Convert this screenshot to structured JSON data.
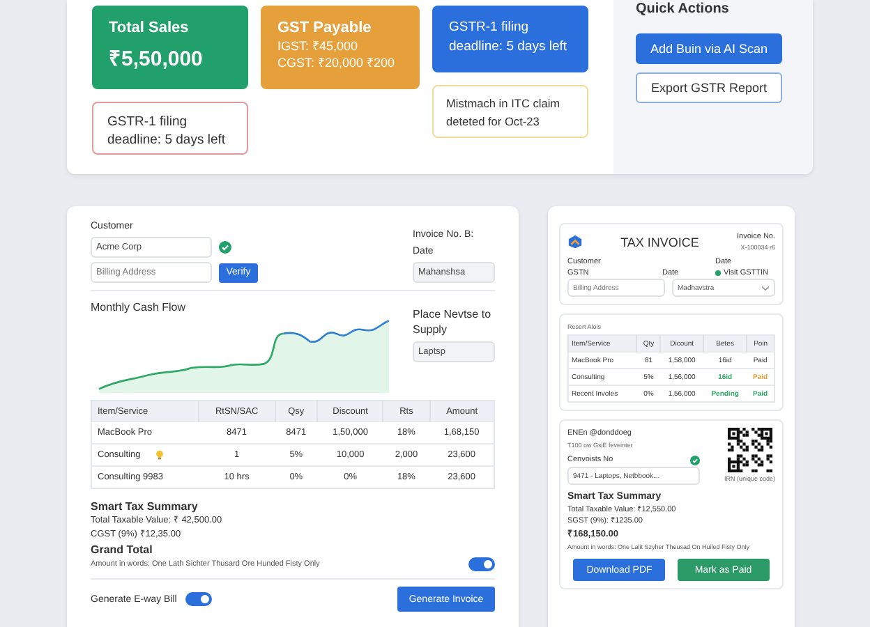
{
  "stats": [
    {
      "title": "Total Sales",
      "value": "₹5,50,000",
      "color": "#21a06b"
    },
    {
      "title": "GST Payable",
      "lines": [
        "IGST: ₹45,000",
        "CGST: ₹20,000 ₹200"
      ],
      "color": "#e5a03c"
    },
    {
      "title": "GSTR-1 filing deadline: 5 days left",
      "color": "#2a6fdb"
    }
  ],
  "alerts": [
    {
      "text": "GSTR-1 filing deadline: 5 days left",
      "color": "#e39a9a"
    },
    {
      "text": "Mistmach in ITC claim deteted for Oct-23",
      "color": "#f0dd9a"
    }
  ],
  "quick_actions": {
    "title": "Quick Actions",
    "buttons": [
      {
        "label": "Add Buin via AI Scan",
        "primary": true
      },
      {
        "label": "Export GSTR Report",
        "primary": false
      }
    ]
  },
  "invoice_form": {
    "customer_label": "Customer",
    "customer_value": "Acme Corp",
    "customer_verified": true,
    "billing_placeholder": "Billing Address",
    "verify_button": "Verify",
    "invoice_no_label": "Invoice No. B:",
    "date_label": "Date",
    "date_value": "Mahanshsa",
    "chart_title": "Monthly Cash Flow",
    "place_label": "Place Nevtse to Supply",
    "place_value": "Laptsp",
    "columns": [
      "Item/Service",
      "RtSN/SAC",
      "Qsy",
      "Discount",
      "Rts",
      "Amount"
    ],
    "rows": [
      {
        "cells": [
          "MacBook Pro",
          "8471",
          "8471",
          "1,50,000",
          "18%",
          "1,68,150"
        ],
        "hint": false
      },
      {
        "cells": [
          "Consulting",
          "1",
          "5%",
          "10,000",
          "2,000",
          "23,600"
        ],
        "hint": true
      },
      {
        "cells": [
          "Consulting   9983",
          "10 hrs",
          "0%",
          "0%",
          "18%",
          "23,600"
        ],
        "hint": false
      }
    ],
    "summary_title": "Smart Tax Summary",
    "summary_lines": [
      "Total Taxable Value: ₹ 42,500.00",
      "CGST (9%) ₹12,35.00"
    ],
    "grand_total_label": "Grand Total",
    "amount_words": "Amount in words: One Lath Sichter Thusard Ore Hunded Fisty Only",
    "words_toggle_on": true,
    "eway_label": "Generate E-way Bill",
    "eway_on": true,
    "generate_button": "Generate Invoice"
  },
  "invoice_preview": {
    "title": "TAX INVOICE",
    "invoice_no_label": "Invoice No.",
    "invoice_no": "X-100034 r6",
    "customer_label": "Customer",
    "date_label": "Date",
    "gstn_label": "GSTN",
    "date_label_2": "Date",
    "visit_label": "Visit GSTTIN",
    "billing_placeholder": "Billing Address",
    "state_value": "Madhavstra",
    "alerts_title": "Resert Alois",
    "columns": [
      "Item/Service",
      "Qty",
      "Dicount",
      "Betes",
      "Poin"
    ],
    "rows": [
      {
        "cells": [
          "MacBook Pro",
          "81",
          "1,58,000"
        ],
        "status": {
          "text": "16id",
          "confirmed": false
        },
        "payment": {
          "text": "Paid",
          "confirmed": false,
          "pending": false
        }
      },
      {
        "cells": [
          "Consulting",
          "5%",
          "1,56,000"
        ],
        "status": {
          "text": "16id",
          "confirmed": true
        },
        "payment": {
          "text": "Paid",
          "confirmed": false,
          "pending": true
        }
      },
      {
        "cells": [
          "Recent Involes",
          "0%",
          "1,56,000"
        ],
        "status": {
          "text": "Pending",
          "confirmed": true
        },
        "payment": {
          "text": "Paid",
          "confirmed": true,
          "pending": false
        }
      }
    ],
    "einv_title": "ENEn @donddoeg",
    "einv_sub": "T100 ow GsiE feveinter",
    "cenv_label": "Cenvoists No",
    "cenv_verified": true,
    "cenv_value": "9471 - Laptops, Netbbook...",
    "irn_label": "IRN (unique code)",
    "summary_title": "Smart Tax Summary",
    "summary_lines": [
      "Total Taxable Value: ₹12,550.00",
      "SGST (9%): ₹1235.00"
    ],
    "total": "₹168,150.00",
    "amount_words": "Amount in words: One Lalit Szyher Theusad On Huiled Fisty Only",
    "buttons": [
      {
        "label": "Download PDF",
        "color": "#2a6fdb"
      },
      {
        "label": "Mark as Paid",
        "color": "#2c9a67"
      }
    ]
  }
}
